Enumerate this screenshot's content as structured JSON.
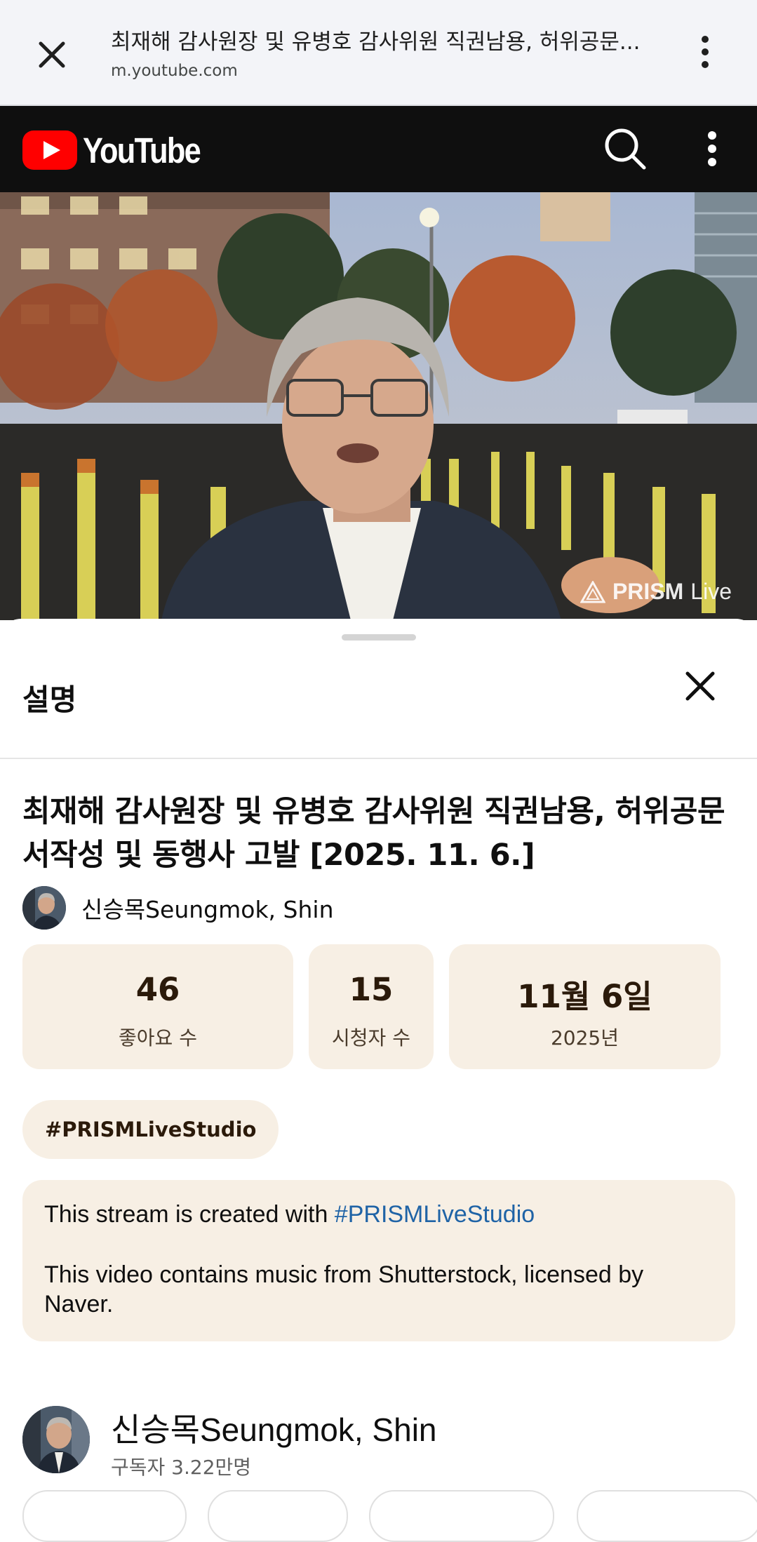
{
  "browser": {
    "title": "최재해 감사원장 및 유병호 감사위원 직권남용, 허위공문...",
    "url": "m.youtube.com"
  },
  "youtube": {
    "logo_text": "YouTube"
  },
  "video": {
    "watermark_brand": "PRISM",
    "watermark_suffix": "Live"
  },
  "sheet": {
    "title": "설명",
    "video_title": "최재해 감사원장 및 유병호 감사위원 직권남용, 허위공문서작성 및 동행사 고발 [2025. 11. 6.]",
    "channel_name": "신승목Seungmok, Shin",
    "stats": [
      {
        "value": "46",
        "label": "좋아요 수"
      },
      {
        "value": "15",
        "label": "시청자 수"
      },
      {
        "value": "11월 6일",
        "label": "2025년"
      }
    ],
    "hashtag": "#PRISMLiveStudio",
    "description": {
      "line1_prefix": "This stream is created with ",
      "line1_link": "#PRISMLiveStudio",
      "line2": "This video contains music from Shutterstock, licensed by Naver."
    },
    "channel_card": {
      "name": "신승목Seungmok, Shin",
      "subscribers": "구독자 3.22만명"
    }
  },
  "colors": {
    "accent_red": "#ff0000",
    "chip_bg": "#f7efe4",
    "link": "#1f63a6"
  }
}
